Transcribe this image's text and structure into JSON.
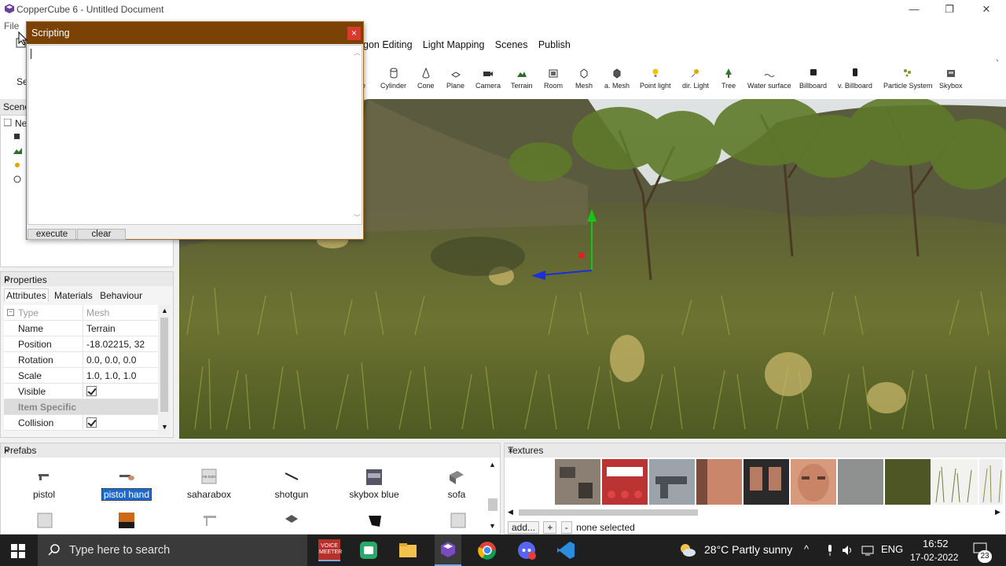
{
  "window": {
    "title": "CopperCube 6 - Untitled Document",
    "minimize": "—",
    "restore": "❐",
    "close": "✕"
  },
  "menu": {
    "file": "File"
  },
  "tabs": [
    "gon Editing",
    "Light Mapping",
    "Scenes",
    "Publish"
  ],
  "toolbar": {
    "partial_label": "e",
    "tools": [
      "Cylinder",
      "Cone",
      "Plane",
      "Camera",
      "Terrain",
      "Room",
      "Mesh",
      "a. Mesh",
      "Point light",
      "dir. Light",
      "Tree",
      "Water surface",
      "Billboard",
      "v. Billboard",
      "Particle System",
      "Skybox"
    ]
  },
  "left_partial": {
    "scene_header": "Scene",
    "new_item": "Ne",
    "se": "Se"
  },
  "scripting": {
    "title": "Scripting",
    "close": "×",
    "editor_text": "",
    "execute_label": "execute",
    "clear_label": "clear"
  },
  "properties": {
    "title": "Properties",
    "close": "×",
    "tabs": [
      "Attributes",
      "Materials",
      "Behaviour"
    ],
    "rows": [
      {
        "key": "Type",
        "value": "Mesh",
        "dim": true
      },
      {
        "key": "Name",
        "value": "Terrain"
      },
      {
        "key": "Position",
        "value": "-18.02215, 32"
      },
      {
        "key": "Rotation",
        "value": "0.0, 0.0, 0.0"
      },
      {
        "key": "Scale",
        "value": "1.0, 1.0, 1.0"
      },
      {
        "key": "Visible",
        "value": "",
        "check": true
      }
    ],
    "group": "Item Specific",
    "collision": {
      "key": "Collision",
      "check": true
    }
  },
  "prefabs": {
    "title": "Prefabs",
    "close": "×",
    "items": [
      "pistol",
      "pistol hand",
      "saharabox",
      "shotgun",
      "skybox blue",
      "sofa"
    ],
    "selected": "pistol hand"
  },
  "textures": {
    "title": "Textures",
    "close": "×",
    "add_label": "add...",
    "plus": "+",
    "minus": "-",
    "status": "none selected"
  },
  "taskbar": {
    "search_placeholder": "Type here to search",
    "voicemeeter": "VOICE MEETER",
    "weather": "28°C  Partly sunny",
    "lang": "ENG",
    "time": "16:52",
    "date": "17-02-2022",
    "notifications": "23"
  },
  "colors": {
    "scripting_title": "#7a4204",
    "selection": "#1b6ad2",
    "taskbar": "#1f1f1f"
  }
}
